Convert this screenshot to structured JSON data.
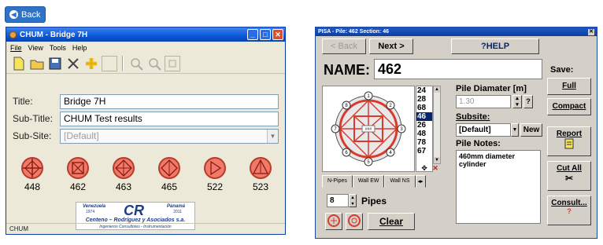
{
  "back_button": {
    "label": "Back"
  },
  "left_window": {
    "title": "CHUM - Bridge 7H",
    "menu": [
      "File",
      "View",
      "Tools",
      "Help"
    ],
    "fields": {
      "title_label": "Title:",
      "title_value": "Bridge 7H",
      "subtitle_label": "Sub-Title:",
      "subtitle_value": "CHUM Test results",
      "subsite_label": "Sub-Site:",
      "subsite_value": "[Default]"
    },
    "piles": [
      {
        "label": "448",
        "icon": "circle-cross-icon"
      },
      {
        "label": "462",
        "icon": "circle-square-x-icon"
      },
      {
        "label": "463",
        "icon": "circle-diamond-icon"
      },
      {
        "label": "465",
        "icon": "circle-diamond-icon"
      },
      {
        "label": "522",
        "icon": "circle-triangle-right-icon"
      },
      {
        "label": "523",
        "icon": "circle-triangle-icon"
      }
    ],
    "logo": {
      "left_city": "Venezuela",
      "left_year": "1974",
      "initials": "CR",
      "right_city": "Panamá",
      "right_year": "2011",
      "company": "Centeno – Rodríguez y Asociados s.a.",
      "tagline": "Ingenieros Consultores  -  Instrumentación"
    },
    "status": "CHUM"
  },
  "right_window": {
    "title": "PISA - Pile: 462 Section: 46",
    "back_label": "< Back",
    "next_label": "Next >",
    "help_label": "?HELP",
    "name_label": "NAME:",
    "name_value": "462",
    "pipe_sections": [
      "24",
      "28",
      "68",
      "46",
      "26",
      "48",
      "78",
      "67"
    ],
    "selected_section": "46",
    "diagram_center": "###",
    "pile_diameter_label": "Pile Diamater [m]",
    "pile_diameter_value": "1.30",
    "subsite_label": "Subsite:",
    "subsite_value": "[Default]",
    "new_label": "New",
    "notes_label": "Pile Notes:",
    "notes_value": "460mm diameter cylinder",
    "tabs": [
      "N-Pipes",
      "Wall EW",
      "Wall NS"
    ],
    "pipes_value": "8",
    "pipes_label": "Pipes",
    "clear_label": "Clear",
    "save_label": "Save:",
    "full_label": "Full",
    "compact_label": "Compact",
    "report_label": "Report",
    "cut_all_label": "Cut All",
    "consult_label": "Consult...",
    "accent_red": "#d83a2e",
    "accent_blue": "#0a246a"
  }
}
